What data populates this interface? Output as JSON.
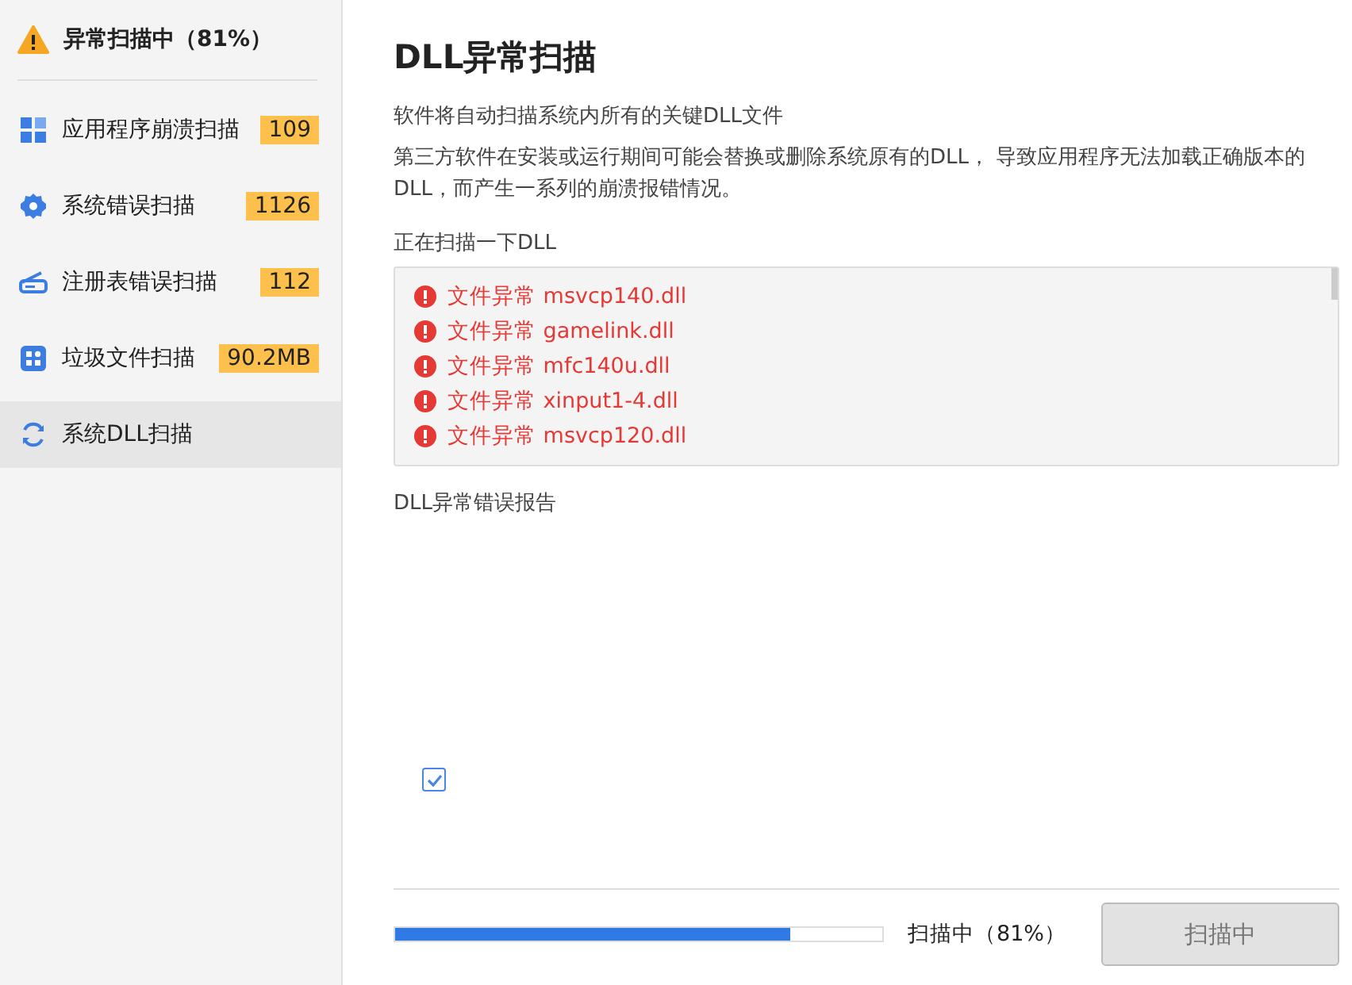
{
  "sidebar": {
    "header": {
      "title": "异常扫描中（81%）"
    },
    "items": [
      {
        "kind": "apps",
        "label": "应用程序崩溃扫描",
        "count": "109",
        "selected": false
      },
      {
        "kind": "gear",
        "label": "系统错误扫描",
        "count": "1126",
        "selected": false
      },
      {
        "kind": "router",
        "label": "注册表错误扫描",
        "count": "112",
        "selected": false
      },
      {
        "kind": "grid",
        "label": "垃圾文件扫描",
        "count": "90.2MB",
        "selected": false
      },
      {
        "kind": "refresh",
        "label": "系统DLL扫描",
        "selected": true
      }
    ]
  },
  "main": {
    "title": "DLL异常扫描",
    "descriptions": [
      "软件将自动扫描系统内所有的关键DLL文件",
      "第三方软件在安装或运行期间可能会替换或删除系统原有的DLL， 导致应用程序无法加载正确版本的DLL，而产生一系列的崩溃报错情况。"
    ],
    "scan_label": "正在扫描一下DLL",
    "scan_results": [
      {
        "status": "文件异常",
        "file": "msvcp140.dll"
      },
      {
        "status": "文件异常",
        "file": "gamelink.dll"
      },
      {
        "status": "文件异常",
        "file": "mfc140u.dll"
      },
      {
        "status": "文件异常",
        "file": "xinput1-4.dll"
      },
      {
        "status": "文件异常",
        "file": "msvcp120.dll"
      }
    ],
    "report_label": "DLL异常错误报告",
    "report_checkbox": {
      "checked": true
    },
    "progress": {
      "level": 0.81,
      "reading": "扫描中（81%）"
    },
    "scan_button": {
      "label": "扫描中",
      "disabled": true
    }
  }
}
